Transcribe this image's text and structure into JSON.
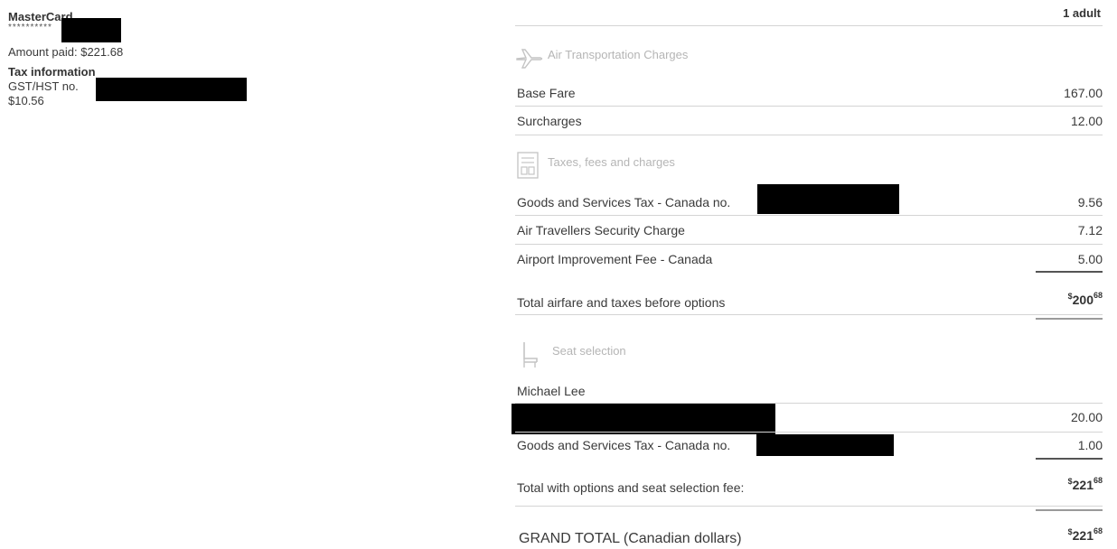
{
  "payment": {
    "card_name": "MasterCard",
    "card_masked": "**********",
    "amount_paid": "Amount paid: $221.68",
    "tax_title": "Tax information",
    "gst_label": "GST/HST no.",
    "gst_amount": "$10.56"
  },
  "passengers": "1 adult",
  "sections": {
    "air": {
      "title": "Air Transportation Charges",
      "icon": "airplane-icon",
      "rows": [
        {
          "label": "Base Fare",
          "value": "167.00"
        },
        {
          "label": "Surcharges",
          "value": "12.00"
        }
      ]
    },
    "taxes": {
      "title": "Taxes, fees and charges",
      "icon": "receipt-icon",
      "rows": [
        {
          "label": "Goods and Services Tax - Canada no.",
          "value": "9.56"
        },
        {
          "label": "Air Travellers Security Charge",
          "value": "7.12"
        },
        {
          "label": "Airport Improvement Fee - Canada",
          "value": "5.00"
        }
      ]
    },
    "subtotal": {
      "label": "Total airfare and taxes before options",
      "currency": "$",
      "whole": "200",
      "cents": "68"
    },
    "seat": {
      "title": "Seat selection",
      "icon": "seat-icon",
      "passenger": "Michael Lee",
      "rows": [
        {
          "label": "",
          "value": "20.00"
        },
        {
          "label": "Goods and Services Tax - Canada no.",
          "value": "1.00"
        }
      ]
    },
    "options_total": {
      "label": "Total with options and seat selection fee:",
      "currency": "$",
      "whole": "221",
      "cents": "68"
    },
    "grand_total": {
      "label": "GRAND TOTAL (Canadian dollars)",
      "currency": "$",
      "whole": "221",
      "cents": "68"
    }
  }
}
